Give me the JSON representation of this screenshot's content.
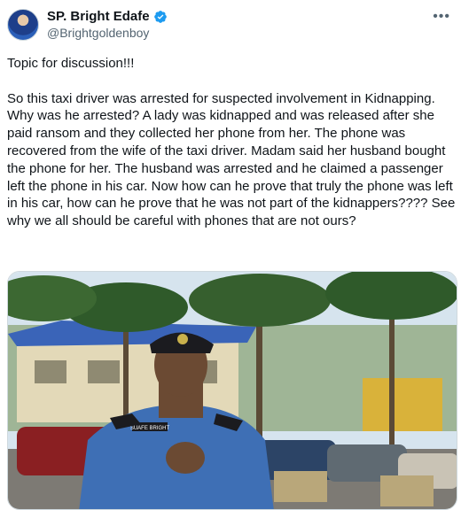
{
  "author": {
    "display_name": "SP. Bright Edafe",
    "handle": "@Brightgoldenboy",
    "verified": true
  },
  "menu": {
    "more_icon": "more-horizontal-icon"
  },
  "tweet": {
    "line1": "Topic for discussion!!!",
    "body": "So this taxi driver was arrested for suspected involvement in Kidnapping. Why was he arrested? A lady was kidnapped and was released after she paid ransom and they collected her phone from her.  The phone was recovered from the wife of the taxi driver. Madam said her husband bought the phone for her. The husband was arrested and he claimed a passenger left the phone in his car. Now how can he prove that truly the phone was left in his car, how can he prove that he was not part of the kidnappers???? See why we all should be careful with phones that are not ours?"
  },
  "media": {
    "badge_text": "SUAFE BRIGHT",
    "colors": {
      "sky": "#d6e4ee",
      "uniform": "#3e6fb5",
      "cap": "#1b1b1f",
      "building": "#e3d9b8",
      "roof": "#3a64b8",
      "palm": "#2f5a2a"
    }
  },
  "accent": "#1d9bf0"
}
